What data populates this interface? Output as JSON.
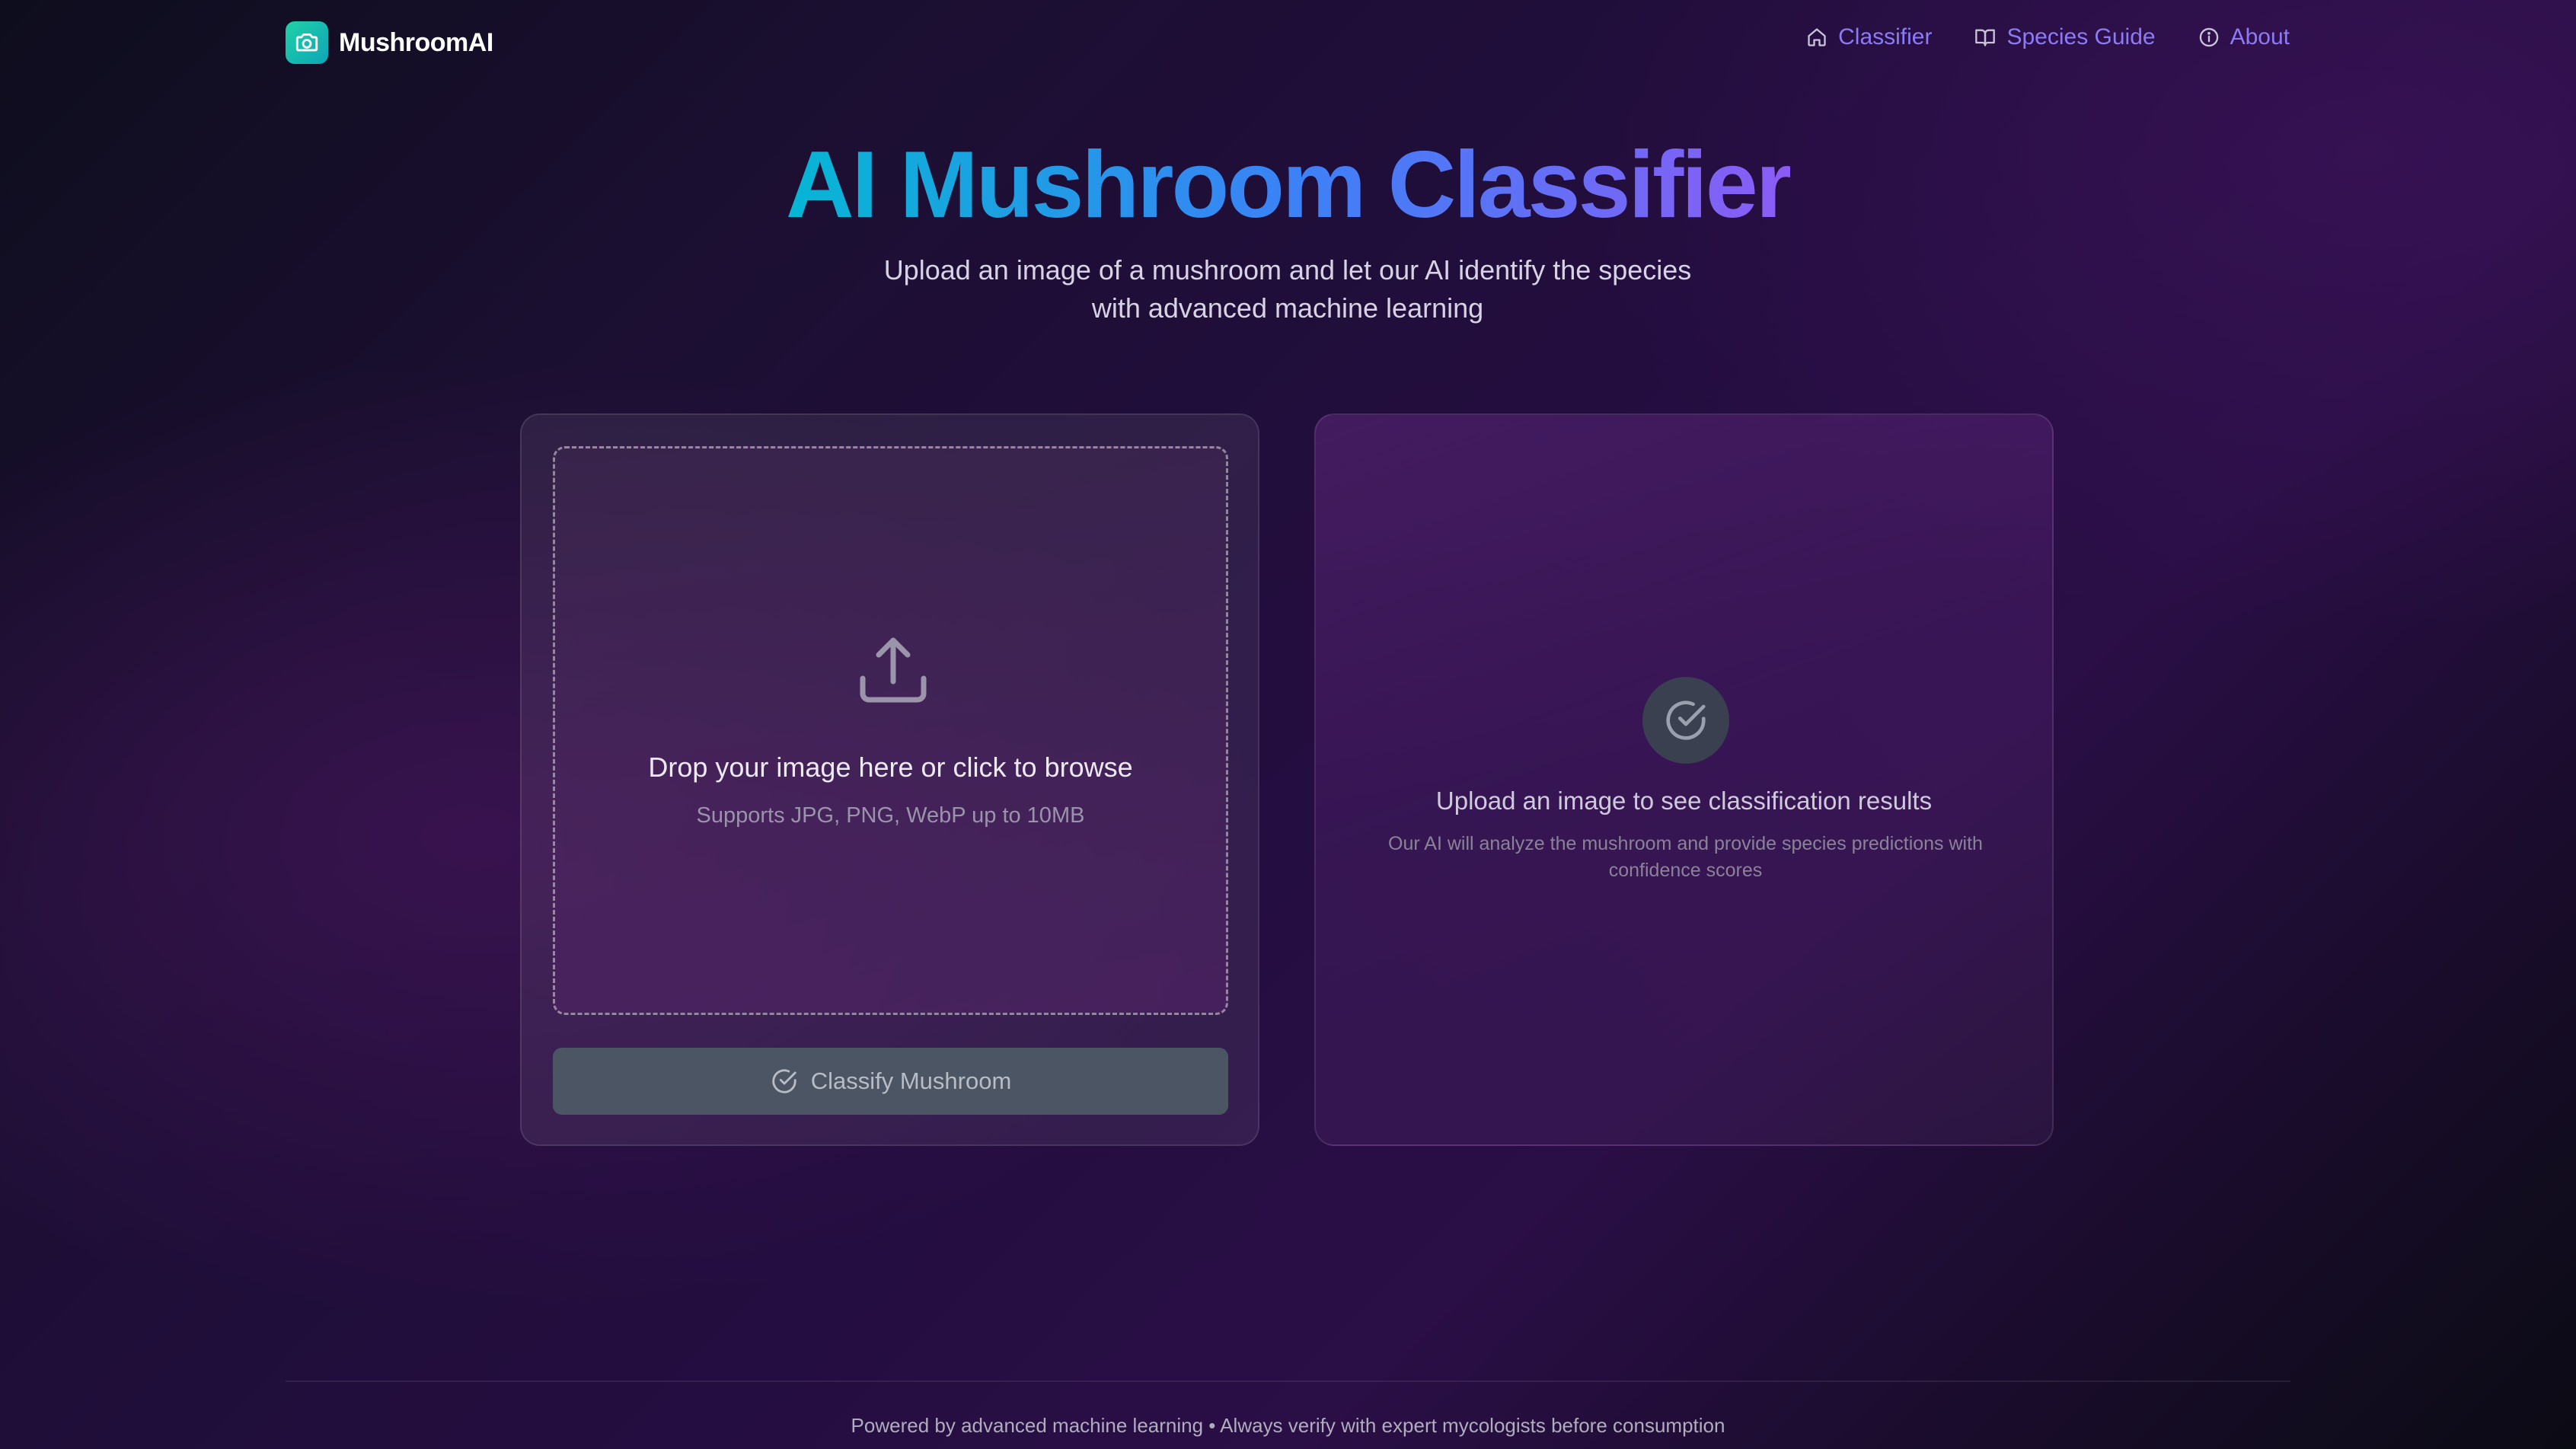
{
  "brand": {
    "name": "MushroomAI",
    "logo_icon": "camera-icon",
    "accent": "#1fd1a5"
  },
  "nav": {
    "items": [
      {
        "label": "Classifier",
        "icon": "home-icon"
      },
      {
        "label": "Species Guide",
        "icon": "book-icon"
      },
      {
        "label": "About",
        "icon": "info-icon"
      }
    ],
    "color": "#8b7cf6"
  },
  "hero": {
    "title": "AI Mushroom Classifier",
    "subtitle_line1": "Upload an image of a mushroom and let our AI identify the species",
    "subtitle_line2": "with advanced machine learning",
    "gradient": [
      "#06b6d4",
      "#3b82f6",
      "#8b5cf6"
    ]
  },
  "upload": {
    "icon": "upload-icon",
    "title": "Drop your image here or click to browse",
    "subtitle": "Supports JPG, PNG, WebP up to 10MB"
  },
  "classify_button": {
    "label": "Classify Mushroom",
    "icon": "check-circle-icon",
    "state": "disabled"
  },
  "results": {
    "icon": "check-circle-icon",
    "title": "Upload an image to see classification results",
    "subtitle_line1": "Our AI will analyze the mushroom and provide species predictions with",
    "subtitle_line2": "confidence scores"
  },
  "footer": {
    "text": "Powered by advanced machine learning • Always verify with expert mycologists before consumption"
  }
}
